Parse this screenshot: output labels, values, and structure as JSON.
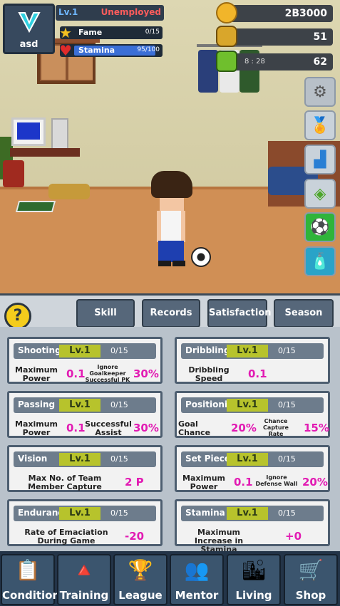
{
  "profile": {
    "name": "asd",
    "level": "Lv.1",
    "job": "Unemployed",
    "fame": {
      "label": "Fame",
      "value": "0/15",
      "fraction": 0.0
    },
    "stamina": {
      "label": "Stamina",
      "value": "95/100",
      "fraction": 0.95
    }
  },
  "currency": {
    "coins": "2B3000",
    "gems": "51",
    "tickets": "62",
    "ticket_timer": "8 : 28"
  },
  "side_buttons": [
    {
      "name": "settings",
      "icon": "gear-icon"
    },
    {
      "name": "medal",
      "icon": "medal-icon"
    },
    {
      "name": "ranking",
      "icon": "ranking-icon"
    },
    {
      "name": "ticket",
      "icon": "ticket-icon"
    },
    {
      "name": "soccer",
      "icon": "soccer-ball-icon"
    },
    {
      "name": "boost",
      "icon": "energy-drink-icon"
    }
  ],
  "panel": {
    "help": "?",
    "tabs": [
      "Skill Ability",
      "Records",
      "Satisfaction",
      "Season Data"
    ]
  },
  "skills": [
    {
      "title": "Shooting",
      "level": "Lv.1",
      "progress": "0/15",
      "stat1_label": "Maximum Power",
      "stat1_value": "0.1",
      "stat2_label": "Ignore Goalkeeper Successful PK",
      "stat2_value": "30%"
    },
    {
      "title": "Dribbling",
      "level": "Lv.1",
      "progress": "0/15",
      "stat1_label": "Dribbling Speed",
      "stat1_value": "0.1"
    },
    {
      "title": "Passing",
      "level": "Lv.1",
      "progress": "0/15",
      "stat1_label": "Maximum Power",
      "stat1_value": "0.1",
      "stat2_label": "Successful Assist",
      "stat2_value": "30%"
    },
    {
      "title": "Positioning",
      "level": "Lv.1",
      "progress": "0/15",
      "stat1_label": "Goal Chance",
      "stat1_value": "20%",
      "stat2_label": "Chance Capture Rate",
      "stat2_value": "15%"
    },
    {
      "title": "Vision",
      "level": "Lv.1",
      "progress": "0/15",
      "stat1_label": "Max No. of Team Member Capture",
      "stat1_value": "2 P"
    },
    {
      "title": "Set Piece",
      "level": "Lv.1",
      "progress": "0/15",
      "stat1_label": "Maximum Power",
      "stat1_value": "0.1",
      "stat2_label": "Ignore Defense Wall",
      "stat2_value": "20%"
    },
    {
      "title": "Endurance",
      "level": "Lv.1",
      "progress": "0/15",
      "stat1_label": "Rate of Emaciation During Game",
      "stat1_value": "-20"
    },
    {
      "title": "Stamina",
      "level": "Lv.1",
      "progress": "0/15",
      "stat1_label": "Maximum Increase in Stamina",
      "stat1_value": "+0"
    }
  ],
  "nav": [
    {
      "label": "Condition",
      "icon": "clipboard-icon"
    },
    {
      "label": "Training",
      "icon": "cones-icon"
    },
    {
      "label": "League",
      "icon": "trophy-icon"
    },
    {
      "label": "Mentor",
      "icon": "mentor-icon"
    },
    {
      "label": "Living",
      "icon": "city-icon"
    },
    {
      "label": "Shop",
      "icon": "cart-icon"
    }
  ]
}
